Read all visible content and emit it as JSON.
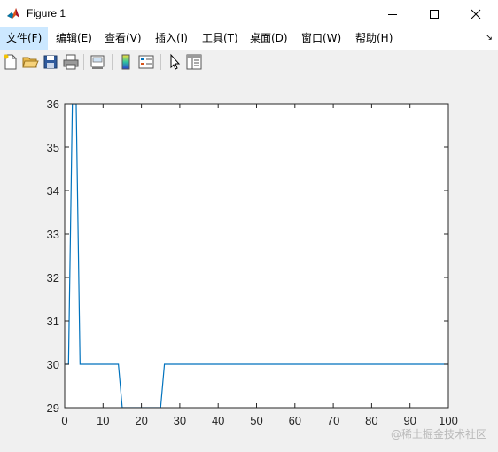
{
  "window": {
    "title": "Figure 1",
    "app_icon": "matlab-logo-icon",
    "controls": {
      "minimize": "—",
      "maximize": "☐",
      "close": "✕"
    }
  },
  "menubar": {
    "items": [
      {
        "label": "文件(F)",
        "active": true
      },
      {
        "label": "编辑(E)"
      },
      {
        "label": "查看(V)"
      },
      {
        "label": "插入(I)"
      },
      {
        "label": "工具(T)"
      },
      {
        "label": "桌面(D)"
      },
      {
        "label": "窗口(W)"
      },
      {
        "label": "帮助(H)"
      }
    ],
    "corner_glyph": "↘"
  },
  "toolbar": {
    "buttons": [
      "new-figure-icon",
      "open-file-icon",
      "save-icon",
      "print-icon",
      "link-plot-icon",
      "insert-colorbar-icon",
      "insert-legend-icon",
      "edit-plot-cursor-icon",
      "property-inspector-icon"
    ]
  },
  "colors": {
    "line": "#0072bd",
    "axes_bg": "#ffffff",
    "figure_bg": "#f0f0f0",
    "menu_highlight": "#cce8ff"
  },
  "chart_data": {
    "type": "line",
    "xlim": [
      0,
      100
    ],
    "ylim": [
      29,
      36
    ],
    "xticks": [
      0,
      10,
      20,
      30,
      40,
      50,
      60,
      70,
      80,
      90,
      100
    ],
    "yticks": [
      29,
      30,
      31,
      32,
      33,
      34,
      35,
      36
    ],
    "grid": false,
    "series": [
      {
        "color": "#0072bd",
        "x": [
          0,
          1,
          2,
          3,
          4,
          14,
          15,
          25,
          26,
          100
        ],
        "y": [
          30,
          30,
          36,
          36,
          30,
          30,
          29,
          29,
          30,
          30
        ]
      }
    ]
  },
  "watermark": "@稀土掘金技术社区"
}
